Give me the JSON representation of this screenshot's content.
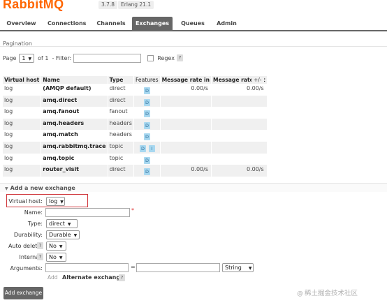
{
  "brand": {
    "logo": "RabbitMQ",
    "version": "3.7.8",
    "erlang": "Erlang 21.1"
  },
  "tabs": [
    {
      "label": "Overview"
    },
    {
      "label": "Connections"
    },
    {
      "label": "Channels"
    },
    {
      "label": "Exchanges",
      "active": true
    },
    {
      "label": "Queues"
    },
    {
      "label": "Admin"
    }
  ],
  "pagination": {
    "title": "Pagination",
    "page_label": "Page",
    "page_value": "1",
    "of_label": "of 1",
    "filter_label": "- Filter:",
    "filter_value": "",
    "regex_label": "Regex",
    "regex_help": "?"
  },
  "table": {
    "columns": [
      "Virtual host",
      "Name",
      "Type",
      "Features",
      "Message rate in",
      "Message rate out"
    ],
    "plus_minus": "+/-",
    "rows": [
      {
        "vhost": "log",
        "name": "(AMQP default)",
        "type": "direct",
        "features": [
          "D"
        ],
        "rate_in": "0.00/s",
        "rate_out": "0.00/s"
      },
      {
        "vhost": "log",
        "name": "amq.direct",
        "type": "direct",
        "features": [
          "D"
        ],
        "rate_in": "",
        "rate_out": ""
      },
      {
        "vhost": "log",
        "name": "amq.fanout",
        "type": "fanout",
        "features": [
          "D"
        ],
        "rate_in": "",
        "rate_out": ""
      },
      {
        "vhost": "log",
        "name": "amq.headers",
        "type": "headers",
        "features": [
          "D"
        ],
        "rate_in": "",
        "rate_out": ""
      },
      {
        "vhost": "log",
        "name": "amq.match",
        "type": "headers",
        "features": [
          "D"
        ],
        "rate_in": "",
        "rate_out": ""
      },
      {
        "vhost": "log",
        "name": "amq.rabbitmq.trace",
        "type": "topic",
        "features": [
          "D",
          "I"
        ],
        "rate_in": "",
        "rate_out": ""
      },
      {
        "vhost": "log",
        "name": "amq.topic",
        "type": "topic",
        "features": [
          "D"
        ],
        "rate_in": "",
        "rate_out": ""
      },
      {
        "vhost": "log",
        "name": "router_visit",
        "type": "direct",
        "features": [
          "D"
        ],
        "rate_in": "0.00/s",
        "rate_out": "0.00/s"
      }
    ]
  },
  "add_exchange": {
    "title": "Add a new exchange",
    "virtual_host_label": "Virtual host:",
    "virtual_host_value": "log",
    "name_label": "Name:",
    "name_value": "",
    "required_mark": "*",
    "type_label": "Type:",
    "type_value": "direct",
    "durability_label": "Durability:",
    "durability_value": "Durable",
    "auto_delete_label": "Auto delete:",
    "auto_delete_value": "No",
    "internal_label": "Internal:",
    "internal_value": "No",
    "arguments_label": "Arguments:",
    "arguments_equals": "=",
    "arguments_type": "String",
    "add_small": "Add",
    "alternate_exchange": "Alternate exchange",
    "help": "?",
    "submit_label": "Add exchange"
  },
  "watermark": {
    "at": "@",
    "text": "稀土掘金技术社区"
  }
}
